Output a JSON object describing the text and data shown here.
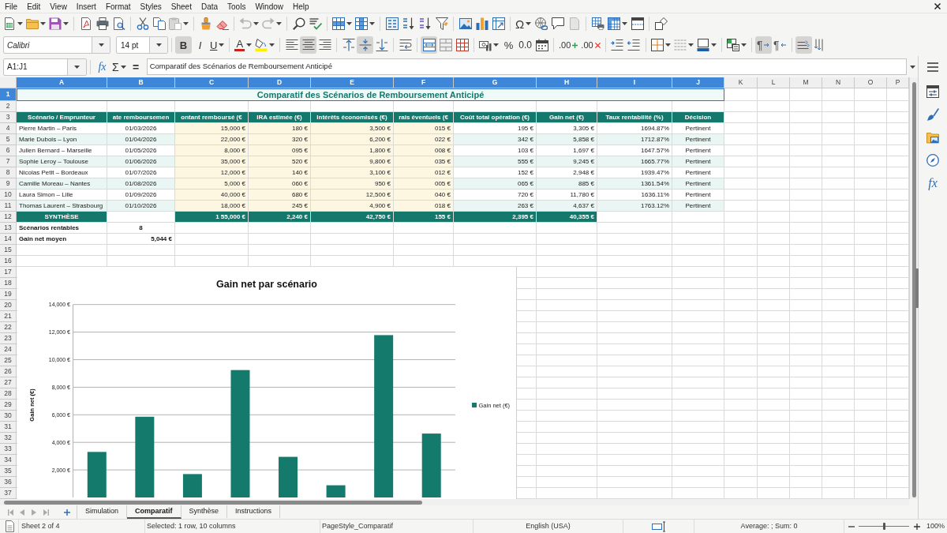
{
  "menu_bar": [
    "File",
    "Edit",
    "View",
    "Insert",
    "Format",
    "Styles",
    "Sheet",
    "Data",
    "Tools",
    "Window",
    "Help"
  ],
  "standard_toolbar": {
    "special_character": "Ω"
  },
  "formatting_toolbar": {
    "font_name": "Calibri",
    "font_size": "14 pt",
    "text_styles": [
      {
        "label": "B",
        "pressed": true
      },
      {
        "label": "I",
        "pressed": false
      },
      {
        "label": "U",
        "pressed": false
      }
    ],
    "font_color": "A",
    "horizontal_align": [
      {
        "selected": false
      },
      {
        "selected": true
      },
      {
        "selected": false
      }
    ],
    "vertical_align": [
      {
        "selected": false
      },
      {
        "selected": true
      },
      {
        "selected": false
      }
    ],
    "merge_and_center": {
      "pressed": true
    },
    "percent": "%",
    "number": "0.0",
    "add_decimal": ".00",
    "delete_decimal": ".00",
    "paragraph_direction": [
      {
        "label": "¶",
        "selected": true
      },
      {
        "label": "¶",
        "selected": false
      }
    ],
    "text_direction": [
      {
        "selected": true
      },
      {
        "selected": false
      }
    ]
  },
  "formula_bar": {
    "name_box": "A1:J1",
    "function_wizard": "fx",
    "sum": "Σ",
    "formula": "=",
    "content": "Comparatif des Scénarios de Remboursement Anticipé"
  },
  "sheet": {
    "columns": [
      {
        "label": "A",
        "selected": true
      },
      {
        "label": "B",
        "selected": true
      },
      {
        "label": "C",
        "selected": true
      },
      {
        "label": "D",
        "selected": true
      },
      {
        "label": "E",
        "selected": true
      },
      {
        "label": "F",
        "selected": true
      },
      {
        "label": "G",
        "selected": true
      },
      {
        "label": "H",
        "selected": true
      },
      {
        "label": "I",
        "selected": true
      },
      {
        "label": "J",
        "selected": true
      },
      {
        "label": "K",
        "selected": false
      },
      {
        "label": "L",
        "selected": false
      },
      {
        "label": "M",
        "selected": false
      },
      {
        "label": "N",
        "selected": false
      },
      {
        "label": "O",
        "selected": false
      },
      {
        "label": "P",
        "selected": false
      }
    ],
    "rows": [
      {
        "label": "1",
        "selected": true
      },
      {
        "label": "2",
        "selected": false
      },
      {
        "label": "3",
        "selected": false
      },
      {
        "label": "4",
        "selected": false
      },
      {
        "label": "5",
        "selected": false
      },
      {
        "label": "6",
        "selected": false
      },
      {
        "label": "7",
        "selected": false
      },
      {
        "label": "8",
        "selected": false
      },
      {
        "label": "9",
        "selected": false
      },
      {
        "label": "10",
        "selected": false
      },
      {
        "label": "11",
        "selected": false
      },
      {
        "label": "12",
        "selected": false
      },
      {
        "label": "13",
        "selected": false
      },
      {
        "label": "14",
        "selected": false
      },
      {
        "label": "15",
        "selected": false
      },
      {
        "label": "16",
        "selected": false
      },
      {
        "label": "17",
        "selected": false
      },
      {
        "label": "18",
        "selected": false
      },
      {
        "label": "19",
        "selected": false
      },
      {
        "label": "20",
        "selected": false
      },
      {
        "label": "21",
        "selected": false
      },
      {
        "label": "22",
        "selected": false
      },
      {
        "label": "23",
        "selected": false
      },
      {
        "label": "24",
        "selected": false
      },
      {
        "label": "25",
        "selected": false
      },
      {
        "label": "26",
        "selected": false
      },
      {
        "label": "27",
        "selected": false
      },
      {
        "label": "28",
        "selected": false
      },
      {
        "label": "29",
        "selected": false
      },
      {
        "label": "30",
        "selected": false
      },
      {
        "label": "31",
        "selected": false
      },
      {
        "label": "32",
        "selected": false
      },
      {
        "label": "33",
        "selected": false
      },
      {
        "label": "34",
        "selected": false
      },
      {
        "label": "35",
        "selected": false
      },
      {
        "label": "36",
        "selected": false
      },
      {
        "label": "37",
        "selected": false
      }
    ],
    "title": "Comparatif des Scénarios de Remboursement Anticipé",
    "header": [
      "Scénario / Emprunteur",
      "ate remboursemen",
      "ontant remboursé (€",
      "IRA estimée (€)",
      "Intérêts économisés (€)",
      "rais éventuels (€",
      "Coût total opération (€)",
      "Gain net (€)",
      "Taux rentabilité (%)",
      "Décision"
    ],
    "records": [
      [
        "Pierre Martin – Paris",
        "01/03/2026",
        "15,000 €",
        "180 €",
        "3,500 €",
        "015 €",
        "195 €",
        "3,305 €",
        "1694.87%",
        "Pertinent"
      ],
      [
        "Marie Dubois – Lyon",
        "01/04/2026",
        "22,000 €",
        "320 €",
        "6,200 €",
        "022 €",
        "342 €",
        "5,858 €",
        "1712.87%",
        "Pertinent"
      ],
      [
        "Julien Bernard – Marseille",
        "01/05/2026",
        "8,000 €",
        "095 €",
        "1,800 €",
        "008 €",
        "103 €",
        "1,697 €",
        "1647.57%",
        "Pertinent"
      ],
      [
        "Sophie Leroy – Toulouse",
        "01/06/2026",
        "35,000 €",
        "520 €",
        "9,800 €",
        "035 €",
        "555 €",
        "9,245 €",
        "1665.77%",
        "Pertinent"
      ],
      [
        "Nicolas Petit – Bordeaux",
        "01/07/2026",
        "12,000 €",
        "140 €",
        "3,100 €",
        "012 €",
        "152 €",
        "2,948 €",
        "1939.47%",
        "Pertinent"
      ],
      [
        "Camille Moreau – Nantes",
        "01/08/2026",
        "5,000 €",
        "060 €",
        "950 €",
        "005 €",
        "065 €",
        "885 €",
        "1361.54%",
        "Pertinent"
      ],
      [
        "Laura Simon – Lille",
        "01/09/2026",
        "40,000 €",
        "680 €",
        "12,500 €",
        "040 €",
        "720 €",
        "11,780 €",
        "1636.11%",
        "Pertinent"
      ],
      [
        "Thomas Laurent – Strasbourg",
        "01/10/2026",
        "18,000 €",
        "245 €",
        "4,900 €",
        "018 €",
        "263 €",
        "4,637 €",
        "1763.12%",
        "Pertinent"
      ]
    ],
    "summary": {
      "label": "SYNTHÈSE",
      "values": [
        "1 55,000 €",
        "2,240 €",
        "42,750 €",
        "155 €",
        "2,395 €",
        "40,355 €"
      ]
    },
    "stats": [
      {
        "label": "Scénarios rentables",
        "value": "8"
      },
      {
        "label": "Gain net moyen",
        "value": "5,044 €"
      }
    ],
    "chart": {
      "chart_data": {
        "type": "bar",
        "title": "Gain net par scénario",
        "ylabel": "Gain net (€)",
        "series": [
          {
            "name": "Gain net (€)",
            "color": "#137a6c",
            "values": [
              3305,
              5858,
              1697,
              9245,
              2948,
              885,
              11780,
              4637
            ]
          }
        ],
        "ylim": [
          0,
          14000
        ],
        "yticks": [
          {
            "value": 2000,
            "label": "2,000 €"
          },
          {
            "value": 4000,
            "label": "4,000 €"
          },
          {
            "value": 6000,
            "label": "6,000 €"
          },
          {
            "value": 8000,
            "label": "8,000 €"
          },
          {
            "value": 10000,
            "label": "10,000 €"
          },
          {
            "value": 12000,
            "label": "12,000 €"
          },
          {
            "value": 14000,
            "label": "14,000 €"
          }
        ],
        "grid": true
      }
    }
  },
  "sheet_tabs": [
    {
      "label": "Simulation",
      "selected": false
    },
    {
      "label": "Comparatif",
      "selected": true
    },
    {
      "label": "Synthèse",
      "selected": false
    },
    {
      "label": "Instructions",
      "selected": false
    }
  ],
  "sidebar": {
    "functions": "fx"
  },
  "status_bar": {
    "sheet": "Sheet 2 of 4",
    "selection": "Selected: 1 row, 10 columns",
    "page_style": "PageStyle_Comparatif",
    "language": "English (USA)",
    "statistics": "Average: ; Sum: 0",
    "zoom_slider": {
      "level": 0.5
    },
    "zoom": "100%"
  }
}
